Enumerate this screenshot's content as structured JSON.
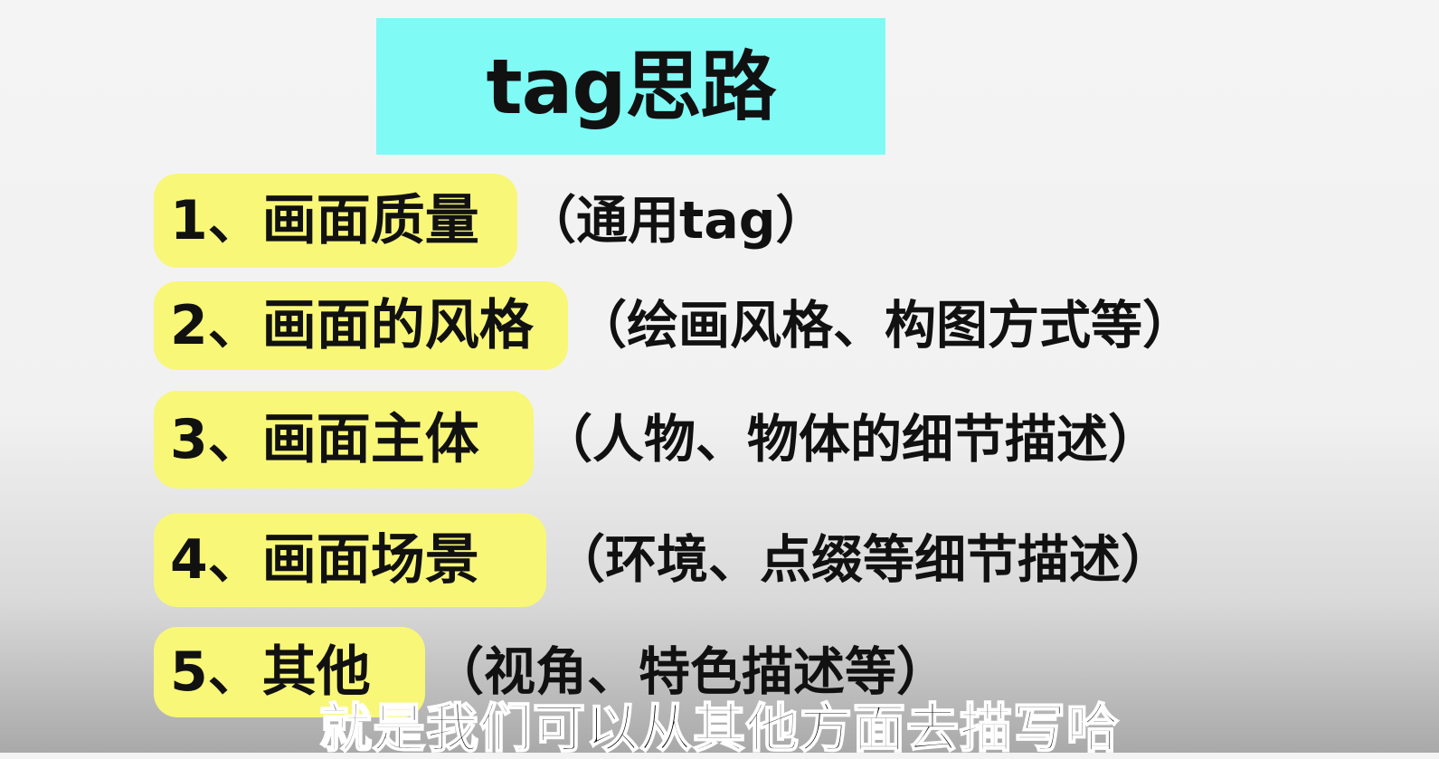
{
  "title": "tag思路",
  "items": [
    {
      "label": "1、画面质量",
      "desc": "（通用tag）"
    },
    {
      "label": "2、画面的风格",
      "desc": "（绘画风格、构图方式等）"
    },
    {
      "label": "3、画面主体",
      "desc": "（人物、物体的细节描述）"
    },
    {
      "label": "4、画面场景",
      "desc": "（环境、点缀等细节描述）"
    },
    {
      "label": "5、其他",
      "desc": "（视角、特色描述等）"
    }
  ],
  "subtitle": "就是我们可以从其他方面去描写哈",
  "colors": {
    "title_bg": "#7ffaf5",
    "highlight_bg": "#f8f778",
    "text": "#111111"
  }
}
